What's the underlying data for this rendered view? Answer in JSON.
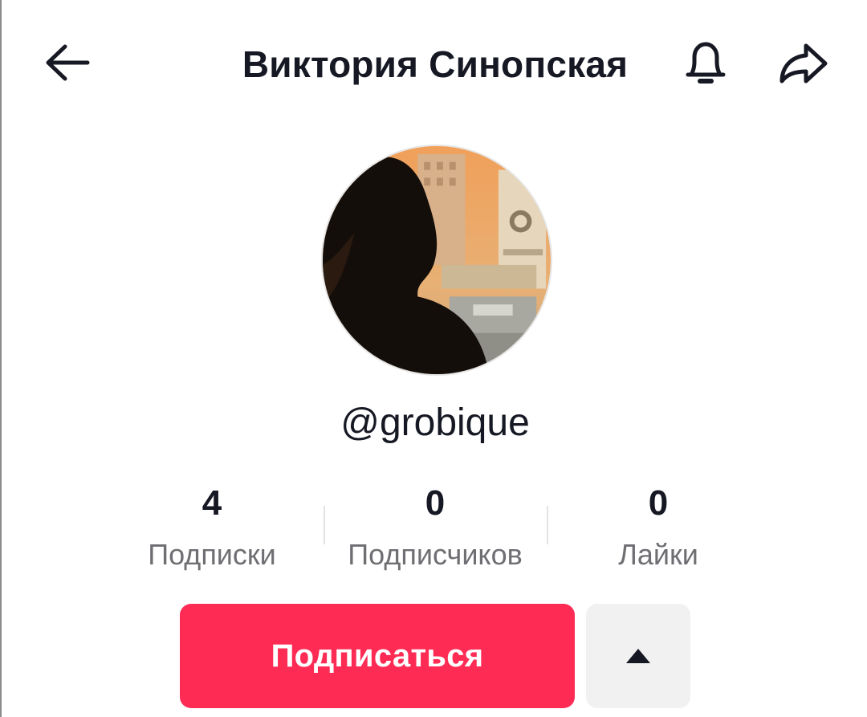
{
  "header": {
    "title": "Виктория Синопская",
    "back_icon": "arrow-left-icon",
    "bell_icon": "bell-icon",
    "share_icon": "share-arrow-icon"
  },
  "profile": {
    "username": "@grobique",
    "avatar": "profile-avatar-image"
  },
  "stats": [
    {
      "value": "4",
      "label": "Подписки"
    },
    {
      "value": "0",
      "label": "Подписчиков"
    },
    {
      "value": "0",
      "label": "Лайки"
    }
  ],
  "actions": {
    "follow_label": "Подписаться",
    "more_icon": "triangle-up-icon"
  },
  "colors": {
    "accent": "#fe2c55",
    "text": "#161823",
    "muted": "#6e6e73",
    "secondary_bg": "#f1f1f2"
  }
}
